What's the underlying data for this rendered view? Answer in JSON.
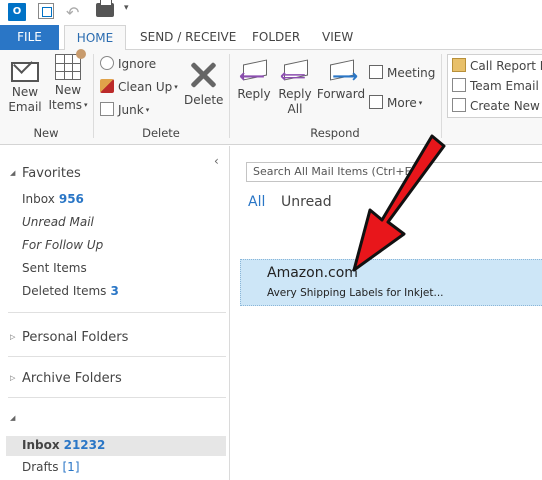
{
  "app": {
    "logo_text": "O"
  },
  "quick_access": {
    "icons": [
      "outlook-logo-icon",
      "send-receive-all-icon",
      "undo-icon",
      "print-icon",
      "customize-quick-access-icon"
    ]
  },
  "tabs": [
    {
      "label": "FILE"
    },
    {
      "label": "HOME"
    },
    {
      "label": "SEND / RECEIVE"
    },
    {
      "label": "FOLDER"
    },
    {
      "label": "VIEW"
    }
  ],
  "ribbon": {
    "new_group": {
      "label": "New",
      "new_email_line1": "New",
      "new_email_line2": "Email",
      "new_items_line1": "New",
      "new_items_line2": "Items"
    },
    "delete_group": {
      "label": "Delete",
      "ignore": "Ignore",
      "clean_up": "Clean Up",
      "junk": "Junk",
      "delete": "Delete"
    },
    "respond_group": {
      "label": "Respond",
      "reply": "Reply",
      "reply_all_line1": "Reply",
      "reply_all_line2": "All",
      "forward": "Forward",
      "meeting": "Meeting",
      "more": "More"
    },
    "quick_steps": {
      "call_report": "Call Report Er",
      "team_email": "Team Email",
      "create_new": "Create New"
    }
  },
  "folder_pane": {
    "collapse_glyph": "‹",
    "favorites": {
      "label": "Favorites",
      "items": [
        {
          "label": "Inbox",
          "count": "956"
        },
        {
          "label": "Unread Mail"
        },
        {
          "label": "For Follow Up"
        },
        {
          "label": "Sent Items"
        },
        {
          "label": "Deleted Items",
          "count": "3"
        }
      ]
    },
    "personal_folders": "Personal Folders",
    "archive_folders": "Archive Folders",
    "account": {
      "label": "",
      "items": [
        {
          "label": "Inbox",
          "count": "21232"
        },
        {
          "label": "Drafts",
          "count": "[1]"
        }
      ]
    }
  },
  "message_list": {
    "search_placeholder": "Search All Mail Items (Ctrl+E)",
    "filters": {
      "all": "All",
      "unread": "Unread"
    },
    "messages": [
      {
        "sender": "Amazon.com",
        "subject": "Avery Shipping Labels for Inkjet..."
      }
    ]
  },
  "colors": {
    "accent": "#2a76c6",
    "selected_message_bg": "#cde6f7",
    "annotation_arrow": "#e8161b"
  }
}
